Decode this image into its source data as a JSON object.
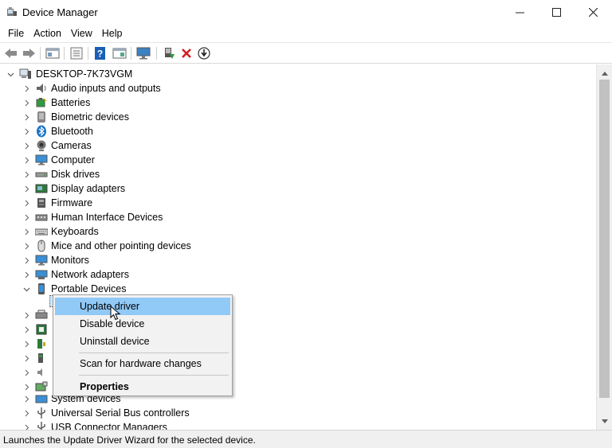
{
  "window": {
    "title": "Device Manager",
    "minimize": "—",
    "maximize": "☐",
    "close": "✕"
  },
  "menu": [
    "File",
    "Action",
    "View",
    "Help"
  ],
  "toolbar": {
    "buttons": [
      "back-arrow-icon",
      "forward-arrow-icon",
      "properties-icon",
      "show-hidden-icon",
      "help-icon",
      "view-icon",
      "monitor-scan-icon",
      "update-driver-icon",
      "uninstall-x-icon",
      "download-arrow-icon"
    ]
  },
  "tree": {
    "root": "DESKTOP-7K73VGM",
    "items": [
      "Audio inputs and outputs",
      "Batteries",
      "Biometric devices",
      "Bluetooth",
      "Cameras",
      "Computer",
      "Disk drives",
      "Display adapters",
      "Firmware",
      "Human Interface Devices",
      "Keyboards",
      "Mice and other pointing devices",
      "Monitors",
      "Network adapters",
      "Portable Devices"
    ],
    "after_menu": [
      "System devices",
      "Universal Serial Bus controllers",
      "USB Connector Managers"
    ]
  },
  "context_menu": {
    "items": [
      "Update driver",
      "Disable device",
      "Uninstall device",
      "Scan for hardware changes",
      "Properties"
    ]
  },
  "status": {
    "text": "Launches the Update Driver Wizard for the selected device."
  },
  "colors": {
    "highlight": "#91c9f7",
    "accent_blue": "#1a73c7",
    "delete_red": "#d41f1f"
  }
}
